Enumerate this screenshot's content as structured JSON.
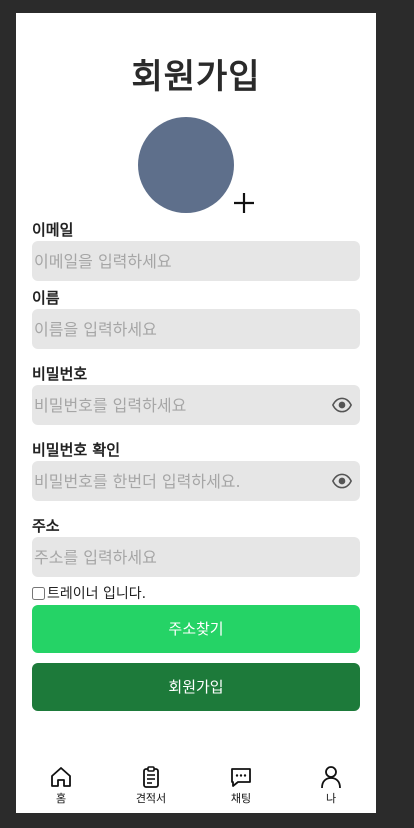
{
  "page": {
    "title": "회원가입"
  },
  "form": {
    "email": {
      "label": "이메일",
      "placeholder": "이메일을 입력하세요"
    },
    "name": {
      "label": "이름",
      "placeholder": "이름을 입력하세요"
    },
    "password": {
      "label": "비밀번호",
      "placeholder": "비밀번호를 입력하세요"
    },
    "password_confirm": {
      "label": "비밀번호 확인",
      "placeholder": "비밀번호를 한번더 입력하세요."
    },
    "address": {
      "label": "주소",
      "placeholder": "주소를 입력하세요"
    },
    "trainer_checkbox_label": "트레이너 입니다.",
    "address_search_button": "주소찾기",
    "signup_button": "회원가입"
  },
  "nav": {
    "items": [
      {
        "label": "홈",
        "icon": "home-icon"
      },
      {
        "label": "견적서",
        "icon": "clipboard-icon"
      },
      {
        "label": "채팅",
        "icon": "chat-icon"
      },
      {
        "label": "나",
        "icon": "user-icon"
      }
    ]
  },
  "colors": {
    "avatar": "#5e6f8b",
    "address_button": "#25d366",
    "signup_button": "#1d7a3a",
    "field_bg": "#e6e6e6"
  }
}
